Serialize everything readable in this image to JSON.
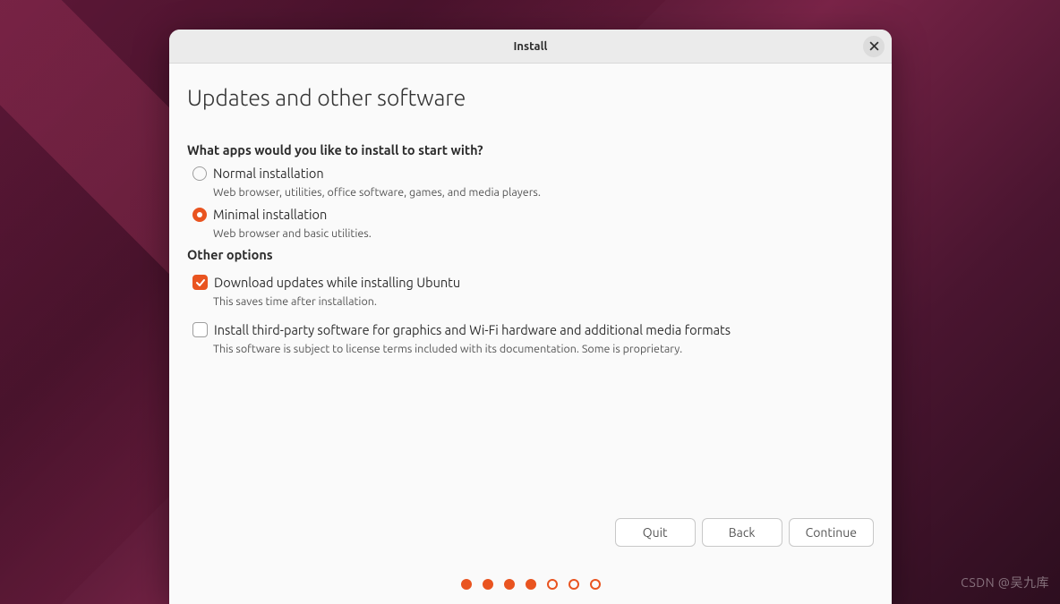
{
  "window": {
    "title": "Install"
  },
  "page": {
    "heading": "Updates and other software"
  },
  "apps_section": {
    "question": "What apps would you like to install to start with?",
    "normal": {
      "label": "Normal installation",
      "desc": "Web browser, utilities, office software, games, and media players.",
      "selected": false
    },
    "minimal": {
      "label": "Minimal installation",
      "desc": "Web browser and basic utilities.",
      "selected": true
    }
  },
  "other_section": {
    "heading": "Other options",
    "download_updates": {
      "label": "Download updates while installing Ubuntu",
      "desc": "This saves time after installation.",
      "checked": true
    },
    "third_party": {
      "label": "Install third-party software for graphics and Wi-Fi hardware and additional media formats",
      "desc": "This software is subject to license terms included with its documentation. Some is proprietary.",
      "checked": false
    }
  },
  "buttons": {
    "quit": "Quit",
    "back": "Back",
    "continue": "Continue"
  },
  "progress": {
    "total": 7,
    "completed": 4
  },
  "watermark": "CSDN @吴九库"
}
